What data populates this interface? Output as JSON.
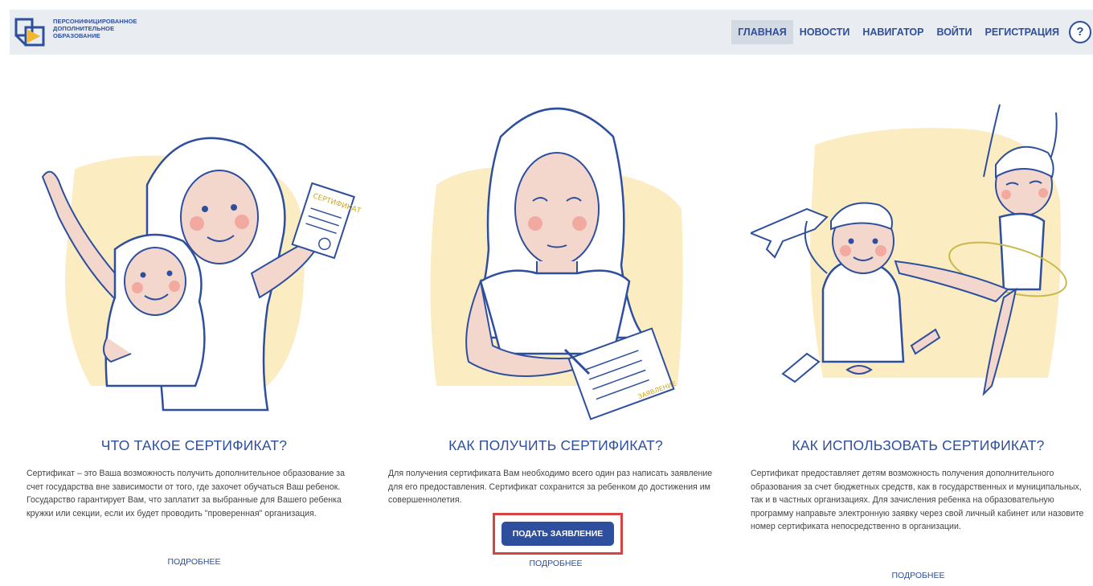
{
  "header": {
    "logo_lines": [
      "ПЕРСОНИФИЦИРОВАННОЕ",
      "ДОПОЛНИТЕЛЬНОЕ",
      "ОБРАЗОВАНИЕ"
    ],
    "nav": [
      {
        "label": "ГЛАВНАЯ",
        "active": true
      },
      {
        "label": "НОВОСТИ",
        "active": false
      },
      {
        "label": "НАВИГАТОР",
        "active": false
      },
      {
        "label": "ВОЙТИ",
        "active": false
      },
      {
        "label": "РЕГИСТРАЦИЯ",
        "active": false
      }
    ],
    "help_label": "?"
  },
  "cards": [
    {
      "title": "ЧТО ТАКОЕ СЕРТИФИКАТ?",
      "description": "Сертификат – это Ваша возможность получить дополнительное образование за счет государства вне зависимости от того, где захочет обучаться Ваш ребенок. Государство гарантирует Вам, что заплатит за выбранные для Вашего ребенка кружки или секции, если их будет проводить \"проверенная\" организация.",
      "more_label": "ПОДРОБНЕЕ",
      "illustration_text": "СЕРТИФИКАТ"
    },
    {
      "title": "КАК ПОЛУЧИТЬ СЕРТИФИКАТ?",
      "description": "Для получения сертификата Вам необходимо всего один раз написать заявление для его предоставления. Сертификат сохранится за ребенком до достижения им совершеннолетия.",
      "button_label": "ПОДАТЬ ЗАЯВЛЕНИЕ",
      "more_label": "ПОДРОБНЕЕ",
      "illustration_text": "ЗАЯВЛЕНИЕ"
    },
    {
      "title": "КАК ИСПОЛЬЗОВАТЬ СЕРТИФИКАТ?",
      "description": "Сертификат предоставляет детям возможность получения дополнительного образования за счет бюджетных средств, как в государственных и муниципальных, так и в частных организациях. Для зачисления ребенка на образовательную программу направьте электронную заявку через свой личный кабинет или назовите номер сертификата непосредственно в организации.",
      "more_label": "ПОДРОБНЕЕ"
    }
  ],
  "colors": {
    "brand_blue": "#2d4f9e",
    "header_bg": "#e9ecf0",
    "illus_yellow": "#fbecc2",
    "skin": "#f4d7cc",
    "highlight_red": "#d64541",
    "logo_yellow": "#f2b632"
  }
}
